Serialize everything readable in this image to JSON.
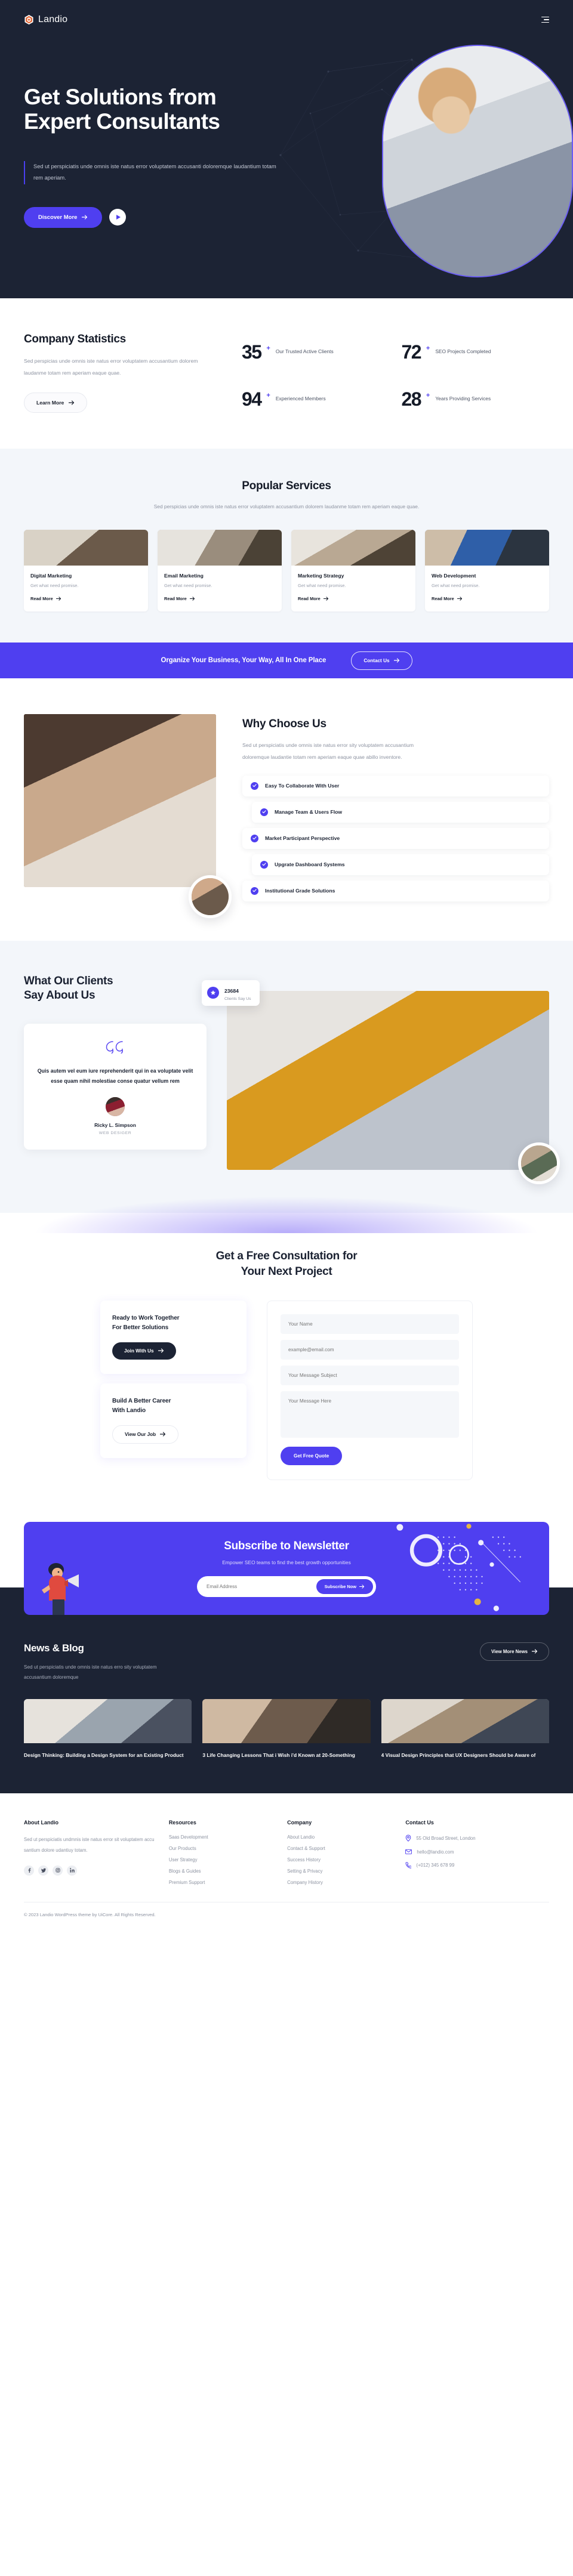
{
  "brand": {
    "name": "Landio",
    "logo_icon": "cube-logo-icon"
  },
  "nav": {
    "menu_icon": "hamburger-menu-icon"
  },
  "hero": {
    "title_line1": "Get Solutions from",
    "title_line2": "Expert Consultants",
    "subtitle": "Sed ut perspiciatis unde omnis iste natus error voluptatem accusanti doloremque laudantium totam rem aperiam.",
    "primary_cta": "Discover More",
    "play_icon": "play-icon",
    "arrow_icon": "arrow-right-icon"
  },
  "stats": {
    "heading": "Company Statistics",
    "description": "Sed perspicias unde omnis iste natus error voluptatem accusantium dolorem laudanme totam rem aperiam eaque quae.",
    "cta": "Learn More",
    "items": [
      {
        "value": "35",
        "suffix": "+",
        "label": "Our Trusted Active Clients"
      },
      {
        "value": "72",
        "suffix": "+",
        "label": "SEO Projects Completed"
      },
      {
        "value": "94",
        "suffix": "+",
        "label": "Experienced Members"
      },
      {
        "value": "28",
        "suffix": "+",
        "label": "Years Providing Services"
      }
    ]
  },
  "services": {
    "heading": "Popular Services",
    "subtitle": "Sed perspicias unde omnis iste natus error voluptatem accusantium dolorem laudanme totam rem aperiam eaque quae.",
    "read_more": "Read More",
    "cards": [
      {
        "title": "Digital Marketing",
        "desc": "Get what need promise."
      },
      {
        "title": "Email Marketing",
        "desc": "Get what need promise."
      },
      {
        "title": "Marketing Strategy",
        "desc": "Get what need promise."
      },
      {
        "title": "Web Development",
        "desc": "Get what need promise."
      }
    ]
  },
  "cta_bar": {
    "text": "Organize Your Business, Your Way, All In One Place",
    "button": "Contact Us"
  },
  "why": {
    "heading": "Why Choose Us",
    "description": "Sed ut perspiciatis unde omnis iste natus error sity voluptatem accusantium doloremque laudantie totam rem aperiam eaque quae abillo inventore.",
    "features": [
      "Easy To Collaborate With User",
      "Manage Team & Users Flow",
      "Market Participant Perspective",
      "Upgrate Dashboard Systems",
      "Institutional Grade Solutions"
    ]
  },
  "testimonials": {
    "heading_line1": "What Our Clients",
    "heading_line2": "Say About Us",
    "quote_icon": "quote-icon",
    "quote": "Quis autem vel eum iure reprehenderit qui in ea voluptate velit esse quam nihil molestiae conse quatur vellum rem",
    "author": "Ricky L. Simpson",
    "role": "WEB DESIGER",
    "chip": {
      "count": "23684",
      "label": "Clients Say Us",
      "icon": "star-icon"
    }
  },
  "consultation": {
    "title_line1": "Get a Free Consultation for",
    "title_line2": "Your Next Project",
    "card1": {
      "title_line1": "Ready to Work Together",
      "title_line2": "For Better Solutions",
      "button": "Join With Us"
    },
    "card2": {
      "title_line1": "Build A Better Career",
      "title_line2": "With Landio",
      "button": "View Our Job"
    },
    "form": {
      "name_placeholder": "Your Name",
      "email_placeholder": "example@email.com",
      "subject_placeholder": "Your Message Subject",
      "message_placeholder": "Your Message Here",
      "submit": "Get Free Quote"
    }
  },
  "newsletter": {
    "title": "Subscribe to Newsletter",
    "subtitle": "Empower SEO teams to find the best growth opportunities",
    "input_placeholder": "Email Address",
    "button": "Subscribe Now",
    "megaphone_icon": "megaphone-icon"
  },
  "blog": {
    "heading": "News & Blog",
    "subtitle": "Sed ut perspiciatis unde omnis iste natus erro sity voluptatem accusantium doloremque",
    "view_more": "View More News",
    "posts": [
      {
        "title": "Design Thinking: Building a Design System for an Existing Product"
      },
      {
        "title": "3 Life Changing Lessons That i Wish i'd Known at 20-Something"
      },
      {
        "title": "4 Visual Design Principles that UX Designers Should be Aware of"
      }
    ]
  },
  "footer": {
    "columns": [
      {
        "heading": "About Landio",
        "text": "Sed ut perspiciatis undmnis iste natus error sit voluptatem accu santium dolore udantiuy totam.",
        "socials": [
          "facebook-icon",
          "twitter-icon",
          "instagram-icon",
          "linkedin-icon"
        ]
      },
      {
        "heading": "Resources",
        "links": [
          "Saas Development",
          "Our Products",
          "User Strategy",
          "Blogs & Guides",
          "Premium Support"
        ]
      },
      {
        "heading": "Company",
        "links": [
          "About Landio",
          "Contact & Support",
          "Success History",
          "Setting & Privacy",
          "Company History"
        ]
      },
      {
        "heading": "Contact Us",
        "contacts": [
          {
            "icon": "location-pin-icon",
            "text": "55 Old Broad Street, London"
          },
          {
            "icon": "envelope-icon",
            "text": "hello@landio.com"
          },
          {
            "icon": "phone-icon",
            "text": "(+012) 345 678 99"
          }
        ]
      }
    ],
    "copyright": "© 2023 Landio WordPress theme by UiCore. All Rights Reserved."
  },
  "colors": {
    "accent": "#4f3ff0",
    "dark": "#1c2334",
    "light_bg": "#f3f6fa",
    "logo": "#e2622f"
  }
}
